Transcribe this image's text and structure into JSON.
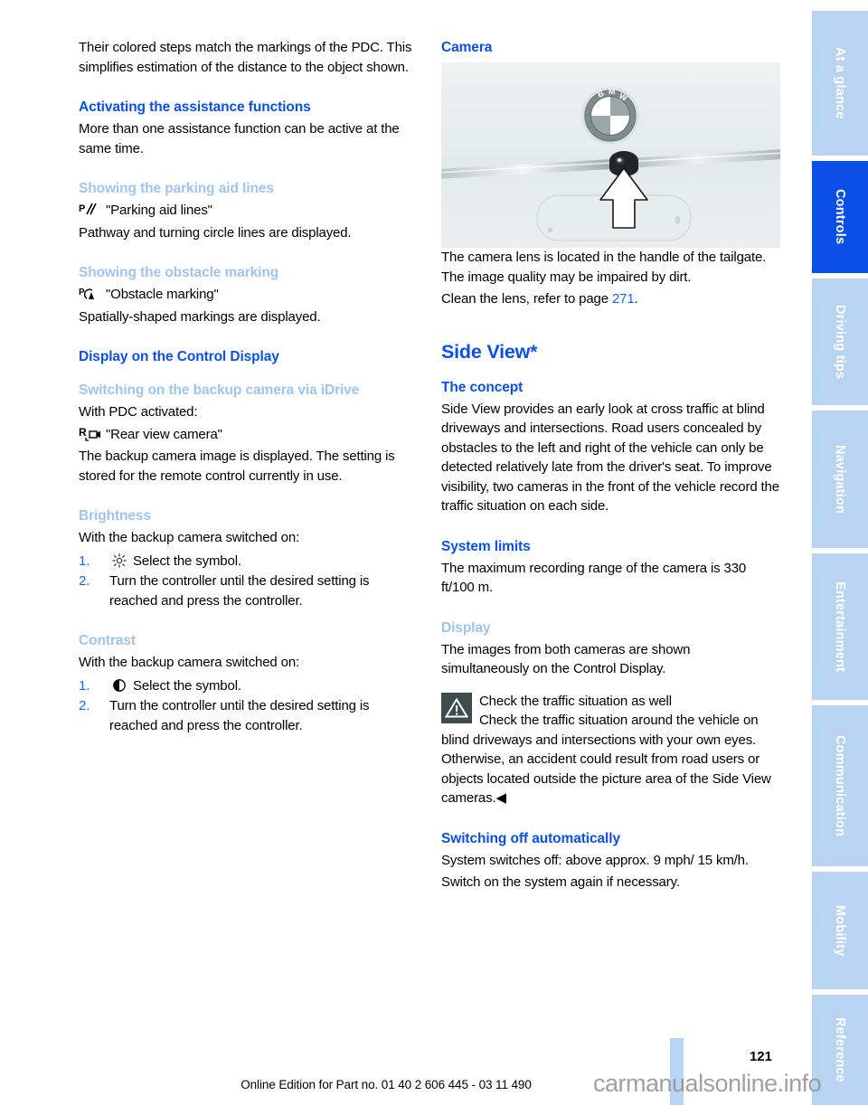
{
  "colors": {
    "heading_primary": "#0a50e6",
    "heading_secondary": "#9fc4ee",
    "link": "#1b64e8",
    "tab_inactive": "#b9d4f2",
    "tab_active": "#0a50e6",
    "warning_icon_bg": "#3f4c4c"
  },
  "left_column": {
    "intro_paragraph": "Their colored steps match the markings of the PDC. This simplifies estimation of the distance to the object shown.",
    "activating": {
      "heading": "Activating the assistance functions",
      "body": "More than one assistance function can be active at the same time."
    },
    "parking_aid_lines": {
      "heading": "Showing the parking aid lines",
      "icon": "parking-aid-lines-icon",
      "menu_label": "\"Parking aid lines\"",
      "body": "Pathway and turning circle lines are displayed."
    },
    "obstacle_marking": {
      "heading": "Showing the obstacle marking",
      "icon": "obstacle-marking-icon",
      "menu_label": "\"Obstacle marking\"",
      "body": "Spatially-shaped markings are displayed."
    },
    "control_display": {
      "heading": "Display on the Control Display"
    },
    "backup_camera_idrive": {
      "heading": "Switching on the backup camera via iDrive",
      "precondition": "With PDC activated:",
      "icon": "rear-view-camera-icon",
      "menu_label": "\"Rear view camera\"",
      "body": "The backup camera image is displayed. The setting is stored for the remote control currently in use."
    },
    "brightness": {
      "heading": "Brightness",
      "precondition": "With the backup camera switched on:",
      "step1_icon": "brightness-sun-icon",
      "step1_num": "1.",
      "step1_text": "Select the symbol.",
      "step2_num": "2.",
      "step2_text": "Turn the controller until the desired setting is reached and press the controller."
    },
    "contrast": {
      "heading": "Contrast",
      "precondition": "With the backup camera switched on:",
      "step1_icon": "contrast-half-circle-icon",
      "step1_num": "1.",
      "step1_text": "Select the symbol.",
      "step2_num": "2.",
      "step2_text": "Turn the controller until the desired setting is reached and press the controller."
    }
  },
  "right_column": {
    "camera": {
      "heading": "Camera",
      "figure_alt": "BMW tailgate with rear view camera lens in the handle, arrow pointing up at the lens",
      "body1": "The camera lens is located in the handle of the tailgate. The image quality may be impaired by dirt.",
      "body2_prefix": "Clean the lens, refer to page ",
      "body2_page": "271",
      "body2_suffix": "."
    },
    "side_view": {
      "title": "Side View*",
      "concept": {
        "heading": "The concept",
        "body": "Side View provides an early look at cross traffic at blind driveways and intersections. Road users concealed by obstacles to the left and right of the vehicle can only be detected relatively late from the driver's seat. To improve visibility, two cameras in the front of the vehicle record the traffic situation on each side."
      },
      "system_limits": {
        "heading": "System limits",
        "body": "The maximum recording range of the camera is 330 ft/100 m."
      },
      "display": {
        "heading": "Display",
        "body": "The images from both cameras are shown simultaneously on the Control Display."
      },
      "warning": {
        "icon": "warning-triangle-icon",
        "title": "Check the traffic situation as well",
        "body": "Check the traffic situation around the vehicle on blind driveways and intersections with your own eyes. Otherwise, an accident could result from road users or objects located outside the picture area of the Side View cameras.",
        "end_mark": "◀"
      },
      "switching_off": {
        "heading": "Switching off automatically",
        "body1": "System switches off: above approx. 9 mph/ 15 km/h.",
        "body2": "Switch on the system again if necessary."
      }
    }
  },
  "sidebar": {
    "tabs": [
      {
        "label": "At a glance",
        "active": false
      },
      {
        "label": "Controls",
        "active": true
      },
      {
        "label": "Driving tips",
        "active": false
      },
      {
        "label": "Navigation",
        "active": false
      },
      {
        "label": "Entertainment",
        "active": false
      },
      {
        "label": "Communication",
        "active": false
      },
      {
        "label": "Mobility",
        "active": false
      },
      {
        "label": "Reference",
        "active": false
      }
    ]
  },
  "footer": {
    "page_number": "121",
    "edition_line": "Online Edition for Part no. 01 40 2 606 445 - 03 11 490",
    "watermark": "carmanualsonline.info"
  }
}
